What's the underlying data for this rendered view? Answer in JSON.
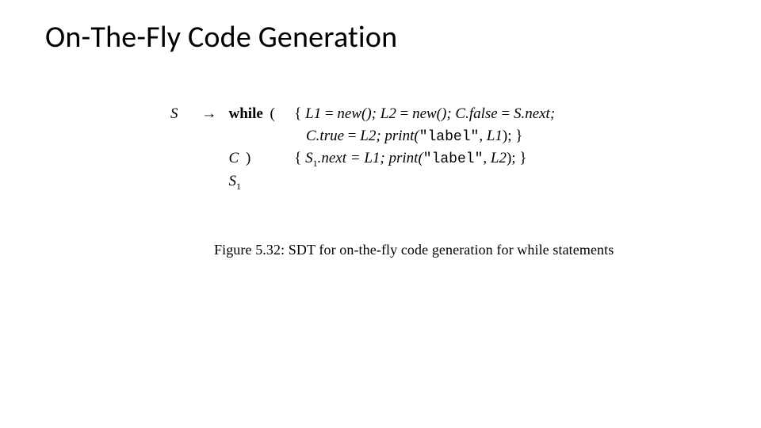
{
  "page": {
    "title": "On-The-Fly Code Generation",
    "caption": "Figure 5.32: SDT for on-the-fly code generation for while statements"
  },
  "prod": {
    "lhs": "S",
    "arrow": "→",
    "keyword": "while",
    "open_paren": "(",
    "cond": "C",
    "close_paren": ")",
    "body_nt": "S",
    "body_sub": "1",
    "line1": {
      "brace": "{",
      "l1a": "L1",
      "eq1": " = ",
      "newfn1": "new();",
      "l2a": " L2",
      "eq2": " = ",
      "newfn2": "new();",
      "cfalse": " C.false",
      "eq3": " = ",
      "snext": "S.next;"
    },
    "line2": {
      "ctrue": "C.true",
      "eq": " = ",
      "l2": "L2;",
      "print": " print(",
      "qlabel": "\"label\"",
      "comma": ", ",
      "l1arg": "L1",
      "endp": ");",
      "brace": " }"
    },
    "line3": {
      "brace": "{",
      "s1next": " S",
      "sub": "1",
      "nexteq": ".next = L1;",
      "print": " print(",
      "qlabel": "\"label\"",
      "comma": ", ",
      "l2arg": "L2",
      "endp": ");",
      "brace2": " }"
    }
  }
}
